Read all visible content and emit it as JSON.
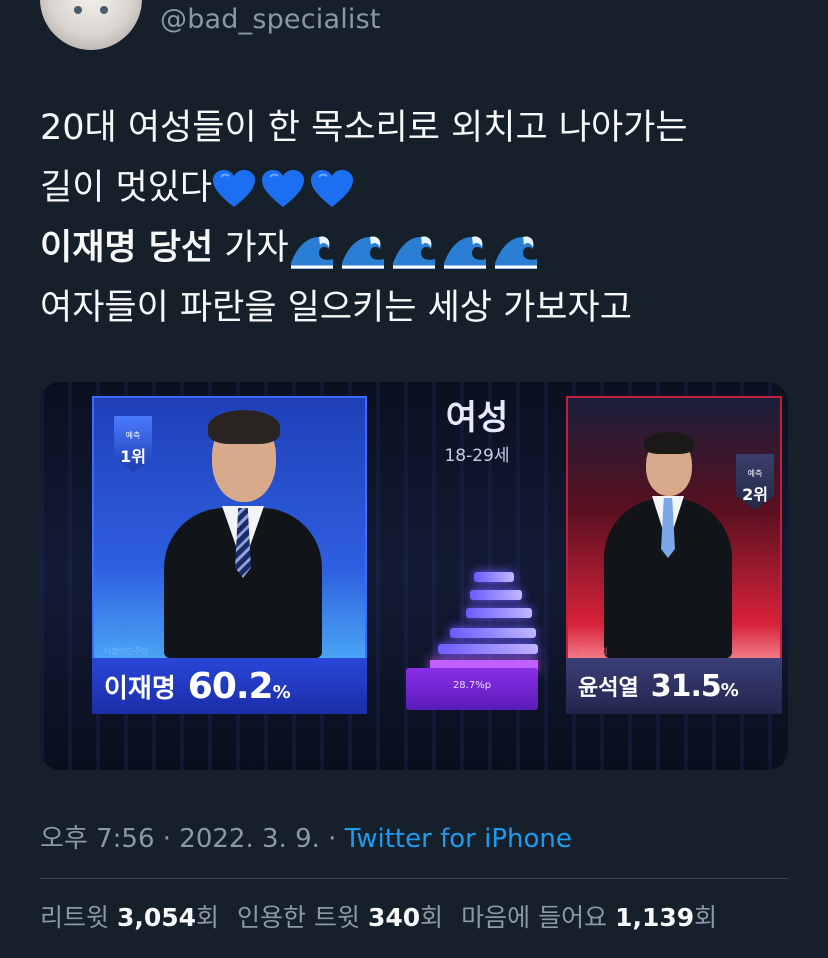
{
  "header": {
    "handle": "@bad_specialist"
  },
  "tweet": {
    "line1": "20대 여성들이 한 목소리로 외치고 나아가는",
    "line2": "길이 멋있다",
    "line2_emoji": [
      "blue-heart",
      "blue-heart",
      "blue-heart"
    ],
    "line3_bold": "이재명 당선",
    "line3_rest": " 가자",
    "line3_emoji": [
      "water-wave",
      "water-wave",
      "water-wave",
      "water-wave",
      "water-wave"
    ],
    "line4": "여자들이 파란을 일으키는 세상 가보자고"
  },
  "media": {
    "center_title": "여성",
    "center_subtitle": "18-29세",
    "center_value": "28.7%p",
    "left": {
      "rank_small": "예측",
      "rank": "1위",
      "party": "더불어민주당",
      "name": "이재명",
      "percent_main": "60.2",
      "percent_unit": "%"
    },
    "right": {
      "rank_small": "예측",
      "rank": "2위",
      "party": "국민의힘",
      "name": "윤석열",
      "percent_main": "31.5",
      "percent_unit": "%"
    }
  },
  "meta": {
    "time": "오후 7:56",
    "sep1": " · ",
    "date": "2022. 3. 9.",
    "sep2": " · ",
    "source": "Twitter for iPhone"
  },
  "stats": {
    "retweets_label": "리트윗 ",
    "retweets": "3,054",
    "retweets_unit": "회",
    "quotes_label": "인용한 트윗 ",
    "quotes": "340",
    "quotes_unit": "회",
    "likes_label": "마음에 들어요 ",
    "likes": "1,139",
    "likes_unit": "회"
  },
  "colors": {
    "background": "#15202b",
    "link": "#1d9bf0",
    "muted": "#8b98a5"
  }
}
